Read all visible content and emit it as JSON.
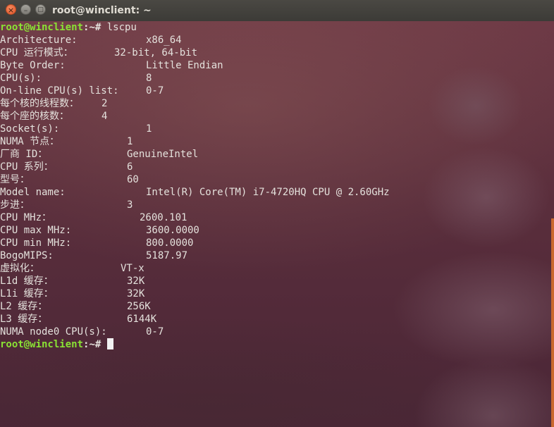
{
  "window": {
    "title": "root@winclient: ~"
  },
  "titlebar_buttons": {
    "close": "×",
    "minimize": "–",
    "maximize": "□"
  },
  "prompt": {
    "user_host": "root@winclient",
    "path_symbol": ":~# ",
    "command": "lscpu"
  },
  "output": [
    {
      "key": "Architecture:",
      "value": "x86_64"
    },
    {
      "key": "CPU 运行模式：",
      "value": "32-bit, 64-bit"
    },
    {
      "key": "Byte Order:",
      "value": "Little Endian"
    },
    {
      "key": "CPU(s):",
      "value": "8"
    },
    {
      "key": "On-line CPU(s) list:",
      "value": "0-7"
    },
    {
      "key": "每个核的线程数：",
      "value": "2"
    },
    {
      "key": "每个座的核数：",
      "value": "4"
    },
    {
      "key": "Socket(s):",
      "value": "1"
    },
    {
      "key": "NUMA 节点：",
      "value": "1"
    },
    {
      "key": "厂商 ID：",
      "value": "GenuineIntel"
    },
    {
      "key": "CPU 系列：",
      "value": "6"
    },
    {
      "key": "型号：",
      "value": "60"
    },
    {
      "key": "Model name:",
      "value": "Intel(R) Core(TM) i7-4720HQ CPU @ 2.60GHz"
    },
    {
      "key": "步进：",
      "value": "3"
    },
    {
      "key": "CPU MHz：",
      "value": "2600.101"
    },
    {
      "key": "CPU max MHz:",
      "value": "3600.0000"
    },
    {
      "key": "CPU min MHz:",
      "value": "800.0000"
    },
    {
      "key": "BogoMIPS:",
      "value": "5187.97"
    },
    {
      "key": "虚拟化：",
      "value": "VT-x"
    },
    {
      "key": "L1d 缓存：",
      "value": "32K"
    },
    {
      "key": "L1i 缓存：",
      "value": "32K"
    },
    {
      "key": "L2 缓存：",
      "value": "256K"
    },
    {
      "key": "L3 缓存：",
      "value": "6144K"
    },
    {
      "key": "NUMA node0 CPU(s):",
      "value": "0-7"
    }
  ],
  "colors": {
    "prompt": "#8ae234",
    "text": "#e4e1dc",
    "accent_strip": "#c9682e"
  }
}
